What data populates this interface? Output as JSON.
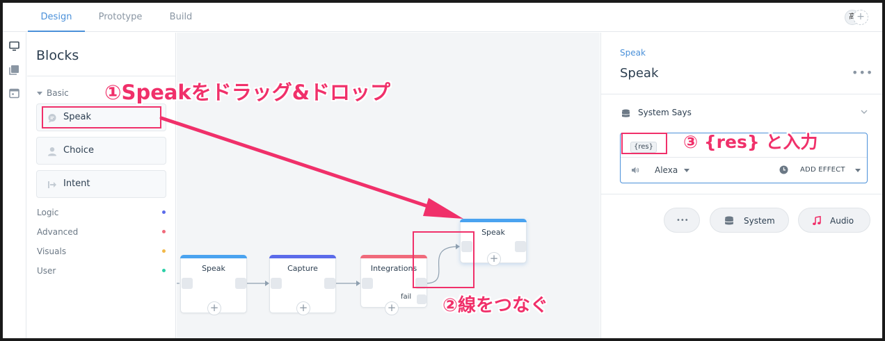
{
  "topbar": {
    "tabs": [
      {
        "label": "Design",
        "active": true
      },
      {
        "label": "Prototype",
        "active": false
      },
      {
        "label": "Build",
        "active": false
      }
    ],
    "avatar_initial": "高",
    "add_collab_label": "+"
  },
  "rail": {
    "icons": [
      "monitor-icon",
      "book-icon",
      "window-icon"
    ]
  },
  "blocks_panel": {
    "title": "Blocks",
    "basic_section": "Basic",
    "basic_items": [
      {
        "label": "Speak",
        "icon": "speech-bubble-icon"
      },
      {
        "label": "Choice",
        "icon": "user-icon"
      },
      {
        "label": "Intent",
        "icon": "arrow-in-icon"
      }
    ],
    "sections": [
      {
        "label": "Logic",
        "color": "#5b6bea"
      },
      {
        "label": "Advanced",
        "color": "#f06a7b"
      },
      {
        "label": "Visuals",
        "color": "#f2b94a"
      },
      {
        "label": "User",
        "color": "#2ccfa7"
      }
    ]
  },
  "canvas": {
    "nodes": [
      {
        "title": "Speak",
        "color": "#4aa3f0"
      },
      {
        "title": "Capture",
        "color": "#5b6bea"
      },
      {
        "title": "Integrations",
        "color": "#f06a7b",
        "fail_label": "fail"
      },
      {
        "title": "Speak",
        "color": "#4aa3f0"
      }
    ],
    "plus_label": "+"
  },
  "right_panel": {
    "breadcrumb": "Speak",
    "title": "Speak",
    "more_label": "•••",
    "system_says_label": "System Says",
    "speech_variable": "{res}",
    "voice": "Alexa",
    "add_effect_label": "ADD EFFECT",
    "pills": [
      {
        "label": "•••",
        "icon": ""
      },
      {
        "label": "System",
        "icon": "database-icon"
      },
      {
        "label": "Audio",
        "icon": "music-note-icon"
      }
    ]
  },
  "annotations": {
    "step1": "①Speakをドラッグ&ドロップ",
    "step2": "②線をつなぐ",
    "step3": "③ {res} と入力",
    "color": "#f0306a"
  }
}
